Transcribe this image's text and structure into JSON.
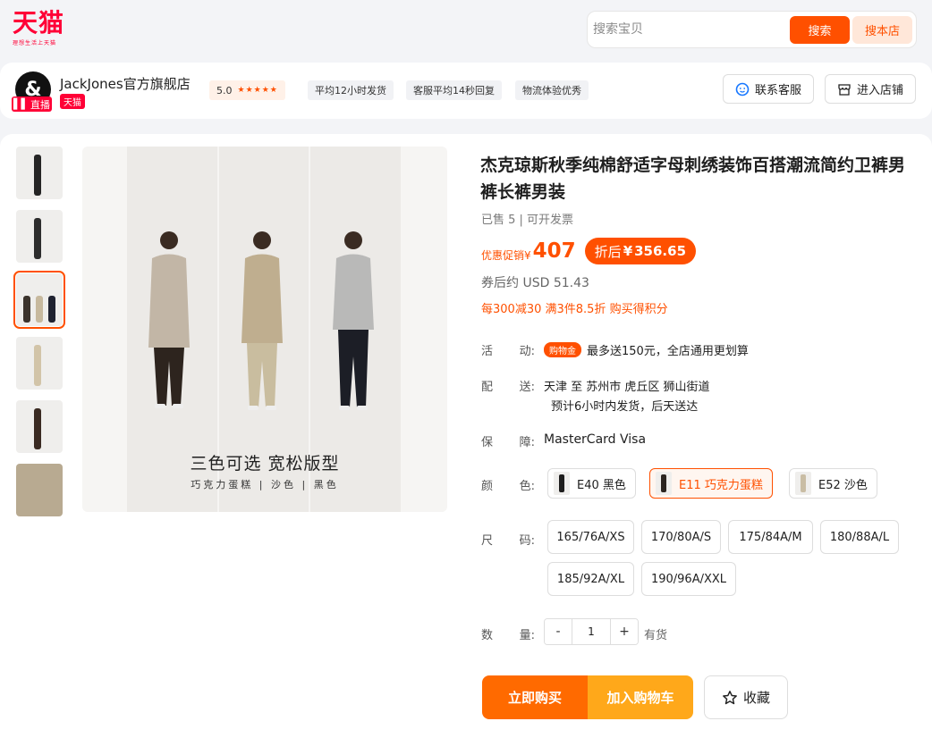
{
  "header": {
    "logo_text": "天猫",
    "logo_tagline": "理想生活上天猫",
    "search_placeholder": "搜索宝贝",
    "search_button": "搜索",
    "search_store_button": "搜本店"
  },
  "shop": {
    "avatar_text": "&",
    "live_label": "直播",
    "name": "JackJones官方旗舰店",
    "tmall_tag": "天猫",
    "rating": "5.0",
    "stars": "★★★★★",
    "chips": [
      "平均12小时发货",
      "客服平均14秒回复",
      "物流体验优秀"
    ],
    "service_button": "联系客服",
    "store_button": "进入店铺"
  },
  "gallery": {
    "caption_main": "三色可选  宽松版型",
    "caption_sub": "巧克力蛋糕  |  沙色  |  黑色"
  },
  "product": {
    "title": "杰克琼斯秋季纯棉舒适字母刺绣装饰百搭潮流简约卫裤男裤长裤男装",
    "sold": "已售 5  |  可开发票",
    "price_label": "优惠促销",
    "currency": "¥",
    "price": "407",
    "after_label": "折后",
    "after_price": "356.65",
    "usd": "券后约 USD 51.43",
    "promo": "每300减30 满3件8.5折 购买得积分"
  },
  "labels": {
    "activity": [
      "活",
      "动:"
    ],
    "delivery": [
      "配",
      "送:"
    ],
    "guarantee": [
      "保",
      "障:"
    ],
    "color": [
      "颜",
      "色:"
    ],
    "size": [
      "尺",
      "码:"
    ],
    "quantity": [
      "数",
      "量:"
    ]
  },
  "activity": {
    "badge": "购物金",
    "text": "最多送150元，全店通用更划算"
  },
  "delivery": {
    "line1": "天津  至  苏州市 虎丘区 狮山街道",
    "line2": "预计6小时内发货，后天送达"
  },
  "guarantee": "MasterCard Visa",
  "colors": [
    {
      "label": "E40 黑色",
      "pants": "#1e1e1e"
    },
    {
      "label": "E11 巧克力蛋糕",
      "pants": "#2c2520"
    },
    {
      "label": "E52 沙色",
      "pants": "#c9bda4"
    }
  ],
  "sizes": [
    "165/76A/XS",
    "170/80A/S",
    "175/84A/M",
    "180/88A/L",
    "185/92A/XL",
    "190/96A/XXL"
  ],
  "quantity": {
    "minus": "-",
    "value": "1",
    "plus": "+",
    "stock": "有货"
  },
  "actions": {
    "buy": "立即购买",
    "cart": "加入购物车",
    "favorite": "收藏"
  }
}
